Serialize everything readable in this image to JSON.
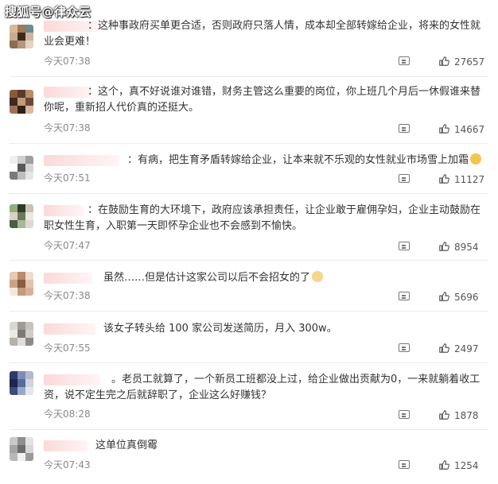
{
  "watermark": "搜狐号@律众云",
  "comments": [
    {
      "text": "：这种事政府买单更合适，否则政府只落人情，成本却全部转嫁给企业，将来的女性就业会更难！",
      "time": "今天07:38",
      "likes": "27657"
    },
    {
      "text": "：这个，真不好说谁对谁错，财务主管这么重要的岗位，你上班几个月后一休假谁来替你呢，重新招人代价真的还挺大。",
      "time": "今天07:38",
      "likes": "14667"
    },
    {
      "text": "：有病，把生育矛盾转嫁给企业，让本来就不乐观的女性就业市场雪上加霜",
      "time": "今天07:51",
      "likes": "11127"
    },
    {
      "text": "：在鼓励生育的大环境下，政府应该承担责任，让企业敢于雇佣孕妇，企业主动鼓励在职女性生育，入职第一天即怀孕企业也不会感到不愉快。",
      "time": "今天07:47",
      "likes": "8954"
    },
    {
      "text": "虽然……但是估计这家公司以后不会招女的了",
      "time": "今天07:38",
      "likes": "5696"
    },
    {
      "text": "该女子转头给 100 家公司发送简历，月入 300w。",
      "time": "今天07:55",
      "likes": "2497"
    },
    {
      "text": "。老员工就算了，一个新员工班都没上过，给企业做出贡献为0，一来就躺着收工资，说不定生完之后就辞职了，企业这么好赚钱？",
      "time": "今天08:28",
      "likes": "1878"
    },
    {
      "text": "这单位真倒霉",
      "time": "今天07:43",
      "likes": "1254"
    }
  ]
}
